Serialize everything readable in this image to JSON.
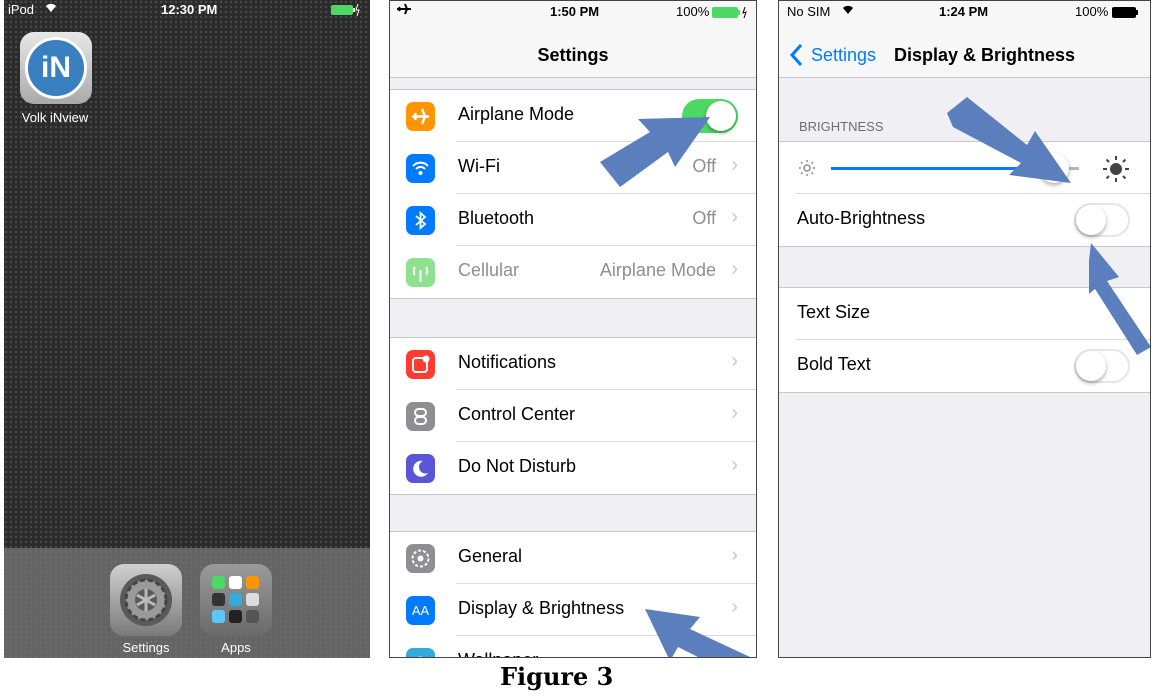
{
  "home": {
    "status": {
      "carrier": "iPod",
      "time": "12:30 PM"
    },
    "app": {
      "label": "Volk iNview",
      "icon_text": "iN"
    },
    "dock": {
      "settings_label": "Settings",
      "apps_label": "Apps"
    }
  },
  "settings": {
    "status": {
      "time": "1:50 PM",
      "battery": "100%"
    },
    "title": "Settings",
    "rows": [
      {
        "label": "Airplane Mode",
        "value": "",
        "icon": "airplane-icon",
        "color": "#ff9500"
      },
      {
        "label": "Wi-Fi",
        "value": "Off",
        "icon": "wifi-icon",
        "color": "#007aff"
      },
      {
        "label": "Bluetooth",
        "value": "Off",
        "icon": "bluetooth-icon",
        "color": "#007aff"
      },
      {
        "label": "Cellular",
        "value": "Airplane Mode",
        "icon": "cellular-icon",
        "color": "#8fe08f"
      },
      {
        "label": "Notifications",
        "value": "",
        "icon": "notifications-icon",
        "color": "#ff3b30"
      },
      {
        "label": "Control Center",
        "value": "",
        "icon": "control-center-icon",
        "color": "#8e8e93"
      },
      {
        "label": "Do Not Disturb",
        "value": "",
        "icon": "moon-icon",
        "color": "#5856d6"
      },
      {
        "label": "General",
        "value": "",
        "icon": "gear-icon",
        "color": "#8e8e93"
      },
      {
        "label": "Display & Brightness",
        "value": "",
        "icon": "display-icon",
        "color": "#007aff"
      },
      {
        "label": "Wallpaper",
        "value": "",
        "icon": "wallpaper-icon",
        "color": "#34aadc"
      }
    ],
    "airplane_on": true
  },
  "display": {
    "status": {
      "carrier": "No SIM",
      "time": "1:24 PM",
      "battery": "100%"
    },
    "back_label": "Settings",
    "title": "Display & Brightness",
    "section_header": "BRIGHTNESS",
    "brightness_level": 0.9,
    "rows": {
      "auto": "Auto-Brightness",
      "text_size": "Text Size",
      "bold": "Bold Text"
    }
  },
  "caption": "Figure 3",
  "colors": {
    "accent": "#007aff",
    "toggle_on": "#4cd964",
    "arrow": "#5b7fbd"
  }
}
